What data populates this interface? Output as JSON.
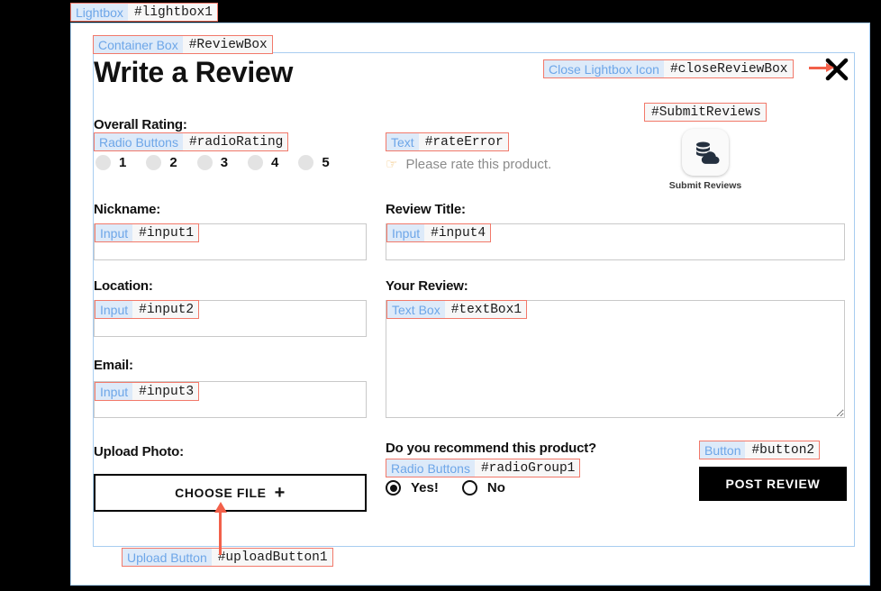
{
  "annotations": {
    "lightbox": {
      "name": "Lightbox",
      "id": "#lightbox1"
    },
    "container": {
      "name": "Container Box",
      "id": "#ReviewBox"
    },
    "close": {
      "name": "Close Lightbox Icon",
      "id": "#closeReviewBox"
    },
    "rating_radios": {
      "name": "Radio Buttons",
      "id": "#radioRating"
    },
    "rate_error": {
      "name": "Text",
      "id": "#rateError"
    },
    "submit_reviews": {
      "name": "",
      "id": "#SubmitReviews"
    },
    "input1": {
      "name": "Input",
      "id": "#input1"
    },
    "input2": {
      "name": "Input",
      "id": "#input2"
    },
    "input3": {
      "name": "Input",
      "id": "#input3"
    },
    "input4": {
      "name": "Input",
      "id": "#input4"
    },
    "textbox1": {
      "name": "Text Box",
      "id": "#textBox1"
    },
    "upload_button": {
      "name": "Upload Button",
      "id": "#uploadButton1"
    },
    "recommend_radios": {
      "name": "Radio Buttons",
      "id": "#radioGroup1"
    },
    "post_button": {
      "name": "Button",
      "id": "#button2"
    }
  },
  "form": {
    "title": "Write a Review",
    "close_icon": "close-x-icon",
    "overall_rating_label": "Overall Rating:",
    "rating_options": [
      "1",
      "2",
      "3",
      "4",
      "5"
    ],
    "rating_selected": null,
    "rate_error_icon": "pointing-hand-icon",
    "rate_error_text": "Please rate this product.",
    "submit_reviews_icon": "database-cloud-icon",
    "submit_reviews_label": "Submit Reviews",
    "nickname_label": "Nickname:",
    "nickname_value": "",
    "location_label": "Location:",
    "location_value": "",
    "email_label": "Email:",
    "email_value": "",
    "review_title_label": "Review Title:",
    "review_title_value": "",
    "your_review_label": "Your Review:",
    "your_review_value": "",
    "upload_photo_label": "Upload Photo:",
    "choose_file_label": "CHOOSE FILE",
    "choose_file_plus": "+",
    "recommend_question": "Do you recommend this product?",
    "recommend_options": [
      {
        "label": "Yes!",
        "selected": true
      },
      {
        "label": "No",
        "selected": false
      }
    ],
    "post_review_label": "POST REVIEW"
  },
  "colors": {
    "annotation_border": "#f2796a",
    "annotation_name_bg": "#ddeaf9",
    "annotation_name_text": "#6da6e8",
    "arrow": "#f2604a",
    "box_border": "#a8cdf0",
    "input_border": "#c9c9c9",
    "rating_dot": "#e3e3e3",
    "error_text": "#8b8b8b",
    "overlay": "#000000"
  }
}
